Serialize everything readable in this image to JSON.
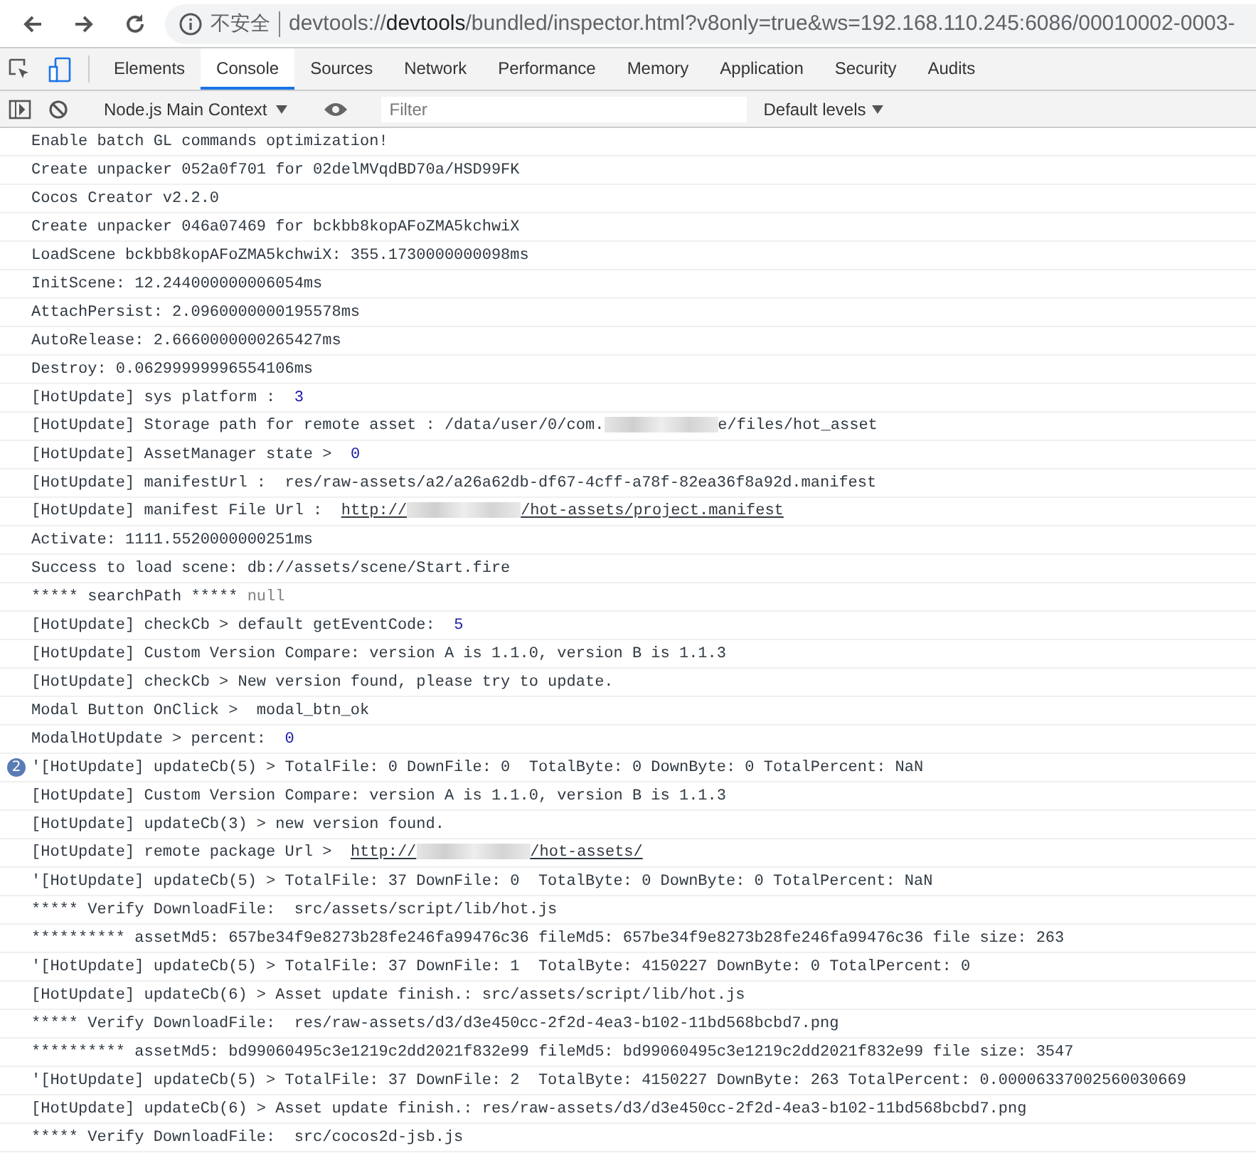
{
  "browser": {
    "security": "不安全",
    "url_prefix": "devtools://",
    "url_host": "devtools",
    "url_rest": "/bundled/inspector.html?v8only=true&ws=192.168.110.245:6086/00010002-0003-"
  },
  "tabs": [
    {
      "label": "Elements",
      "selected": false
    },
    {
      "label": "Console",
      "selected": true
    },
    {
      "label": "Sources",
      "selected": false
    },
    {
      "label": "Network",
      "selected": false
    },
    {
      "label": "Performance",
      "selected": false
    },
    {
      "label": "Memory",
      "selected": false
    },
    {
      "label": "Application",
      "selected": false
    },
    {
      "label": "Security",
      "selected": false
    },
    {
      "label": "Audits",
      "selected": false
    }
  ],
  "toolbar": {
    "context": "Node.js Main Context",
    "filter_placeholder": "Filter",
    "levels": "Default levels"
  },
  "messages": [
    {
      "parts": [
        {
          "kind": "text",
          "text": "Enable batch GL commands optimization!"
        }
      ]
    },
    {
      "parts": [
        {
          "kind": "text",
          "text": "Create unpacker 052a0f701 for 02delMVqdBD70a/HSD99FK"
        }
      ]
    },
    {
      "parts": [
        {
          "kind": "text",
          "text": "Cocos Creator v2.2.0"
        }
      ]
    },
    {
      "parts": [
        {
          "kind": "text",
          "text": "Create unpacker 046a07469 for bckbb8kopAFoZMA5kchwiX"
        }
      ]
    },
    {
      "parts": [
        {
          "kind": "text",
          "text": "LoadScene bckbb8kopAFoZMA5kchwiX: 355.1730000000098ms"
        }
      ]
    },
    {
      "parts": [
        {
          "kind": "text",
          "text": "InitScene: 12.244000000006054ms"
        }
      ]
    },
    {
      "parts": [
        {
          "kind": "text",
          "text": "AttachPersist: 2.0960000000195578ms"
        }
      ]
    },
    {
      "parts": [
        {
          "kind": "text",
          "text": "AutoRelease: 2.6660000000265427ms"
        }
      ]
    },
    {
      "parts": [
        {
          "kind": "text",
          "text": "Destroy: 0.06299999996554106ms"
        }
      ]
    },
    {
      "parts": [
        {
          "kind": "text",
          "text": "[HotUpdate] sys platform :  "
        },
        {
          "kind": "number",
          "text": "3"
        }
      ]
    },
    {
      "parts": [
        {
          "kind": "text",
          "text": "[HotUpdate] Storage path for remote asset : /data/user/0/com."
        },
        {
          "kind": "redacted"
        },
        {
          "kind": "text",
          "text": "e/files/hot_asset"
        }
      ]
    },
    {
      "parts": [
        {
          "kind": "text",
          "text": "[HotUpdate] AssetManager state >  "
        },
        {
          "kind": "number",
          "text": "0"
        }
      ]
    },
    {
      "parts": [
        {
          "kind": "text",
          "text": "[HotUpdate] manifestUrl :  res/raw-assets/a2/a26a62db-df67-4cff-a78f-82ea36f8a92d.manifest"
        }
      ]
    },
    {
      "parts": [
        {
          "kind": "text",
          "text": "[HotUpdate] manifest File Url :  "
        },
        {
          "kind": "link",
          "text": "http://"
        },
        {
          "kind": "redacted"
        },
        {
          "kind": "link",
          "text": "/hot-assets/project.manifest"
        }
      ]
    },
    {
      "parts": [
        {
          "kind": "text",
          "text": "Activate: 1111.5520000000251ms"
        }
      ]
    },
    {
      "parts": [
        {
          "kind": "text",
          "text": "Success to load scene: db://assets/scene/Start.fire"
        }
      ]
    },
    {
      "parts": [
        {
          "kind": "text",
          "text": "***** searchPath ***** "
        },
        {
          "kind": "null",
          "text": "null"
        }
      ]
    },
    {
      "parts": [
        {
          "kind": "text",
          "text": "[HotUpdate] checkCb > default getEventCode:  "
        },
        {
          "kind": "number",
          "text": "5"
        }
      ]
    },
    {
      "parts": [
        {
          "kind": "text",
          "text": "[HotUpdate] Custom Version Compare: version A is 1.1.0, version B is 1.1.3"
        }
      ]
    },
    {
      "parts": [
        {
          "kind": "text",
          "text": "[HotUpdate] checkCb > New version found, please try to update."
        }
      ]
    },
    {
      "parts": [
        {
          "kind": "text",
          "text": "Modal Button OnClick >  modal_btn_ok"
        }
      ]
    },
    {
      "parts": [
        {
          "kind": "text",
          "text": "ModalHotUpdate > percent:  "
        },
        {
          "kind": "number",
          "text": "0"
        }
      ]
    },
    {
      "count": "2",
      "parts": [
        {
          "kind": "text",
          "text": "'[HotUpdate] updateCb(5) > TotalFile: 0 DownFile: 0  TotalByte: 0 DownByte: 0 TotalPercent: NaN"
        }
      ]
    },
    {
      "parts": [
        {
          "kind": "text",
          "text": "[HotUpdate] Custom Version Compare: version A is 1.1.0, version B is 1.1.3"
        }
      ]
    },
    {
      "parts": [
        {
          "kind": "text",
          "text": "[HotUpdate] updateCb(3) > new version found."
        }
      ]
    },
    {
      "parts": [
        {
          "kind": "text",
          "text": "[HotUpdate] remote package Url >  "
        },
        {
          "kind": "link",
          "text": "http://"
        },
        {
          "kind": "redacted"
        },
        {
          "kind": "link",
          "text": "/hot-assets/"
        }
      ]
    },
    {
      "parts": [
        {
          "kind": "text",
          "text": "'[HotUpdate] updateCb(5) > TotalFile: 37 DownFile: 0  TotalByte: 0 DownByte: 0 TotalPercent: NaN"
        }
      ]
    },
    {
      "parts": [
        {
          "kind": "text",
          "text": "***** Verify DownloadFile:  src/assets/script/lib/hot.js"
        }
      ]
    },
    {
      "parts": [
        {
          "kind": "text",
          "text": "********** assetMd5: 657be34f9e8273b28fe246fa99476c36 fileMd5: 657be34f9e8273b28fe246fa99476c36 file size: 263"
        }
      ]
    },
    {
      "parts": [
        {
          "kind": "text",
          "text": "'[HotUpdate] updateCb(5) > TotalFile: 37 DownFile: 1  TotalByte: 4150227 DownByte: 0 TotalPercent: 0"
        }
      ]
    },
    {
      "parts": [
        {
          "kind": "text",
          "text": "[HotUpdate] updateCb(6) > Asset update finish.: src/assets/script/lib/hot.js"
        }
      ]
    },
    {
      "parts": [
        {
          "kind": "text",
          "text": "***** Verify DownloadFile:  res/raw-assets/d3/d3e450cc-2f2d-4ea3-b102-11bd568bcbd7.png"
        }
      ]
    },
    {
      "parts": [
        {
          "kind": "text",
          "text": "********** assetMd5: bd99060495c3e1219c2dd2021f832e99 fileMd5: bd99060495c3e1219c2dd2021f832e99 file size: 3547"
        }
      ]
    },
    {
      "parts": [
        {
          "kind": "text",
          "text": "'[HotUpdate] updateCb(5) > TotalFile: 37 DownFile: 2  TotalByte: 4150227 DownByte: 263 TotalPercent: 0.00006337002560030669"
        }
      ]
    },
    {
      "parts": [
        {
          "kind": "text",
          "text": "[HotUpdate] updateCb(6) > Asset update finish.: res/raw-assets/d3/d3e450cc-2f2d-4ea3-b102-11bd568bcbd7.png"
        }
      ]
    },
    {
      "parts": [
        {
          "kind": "text",
          "text": "***** Verify DownloadFile:  src/cocos2d-jsb.js"
        }
      ]
    }
  ]
}
